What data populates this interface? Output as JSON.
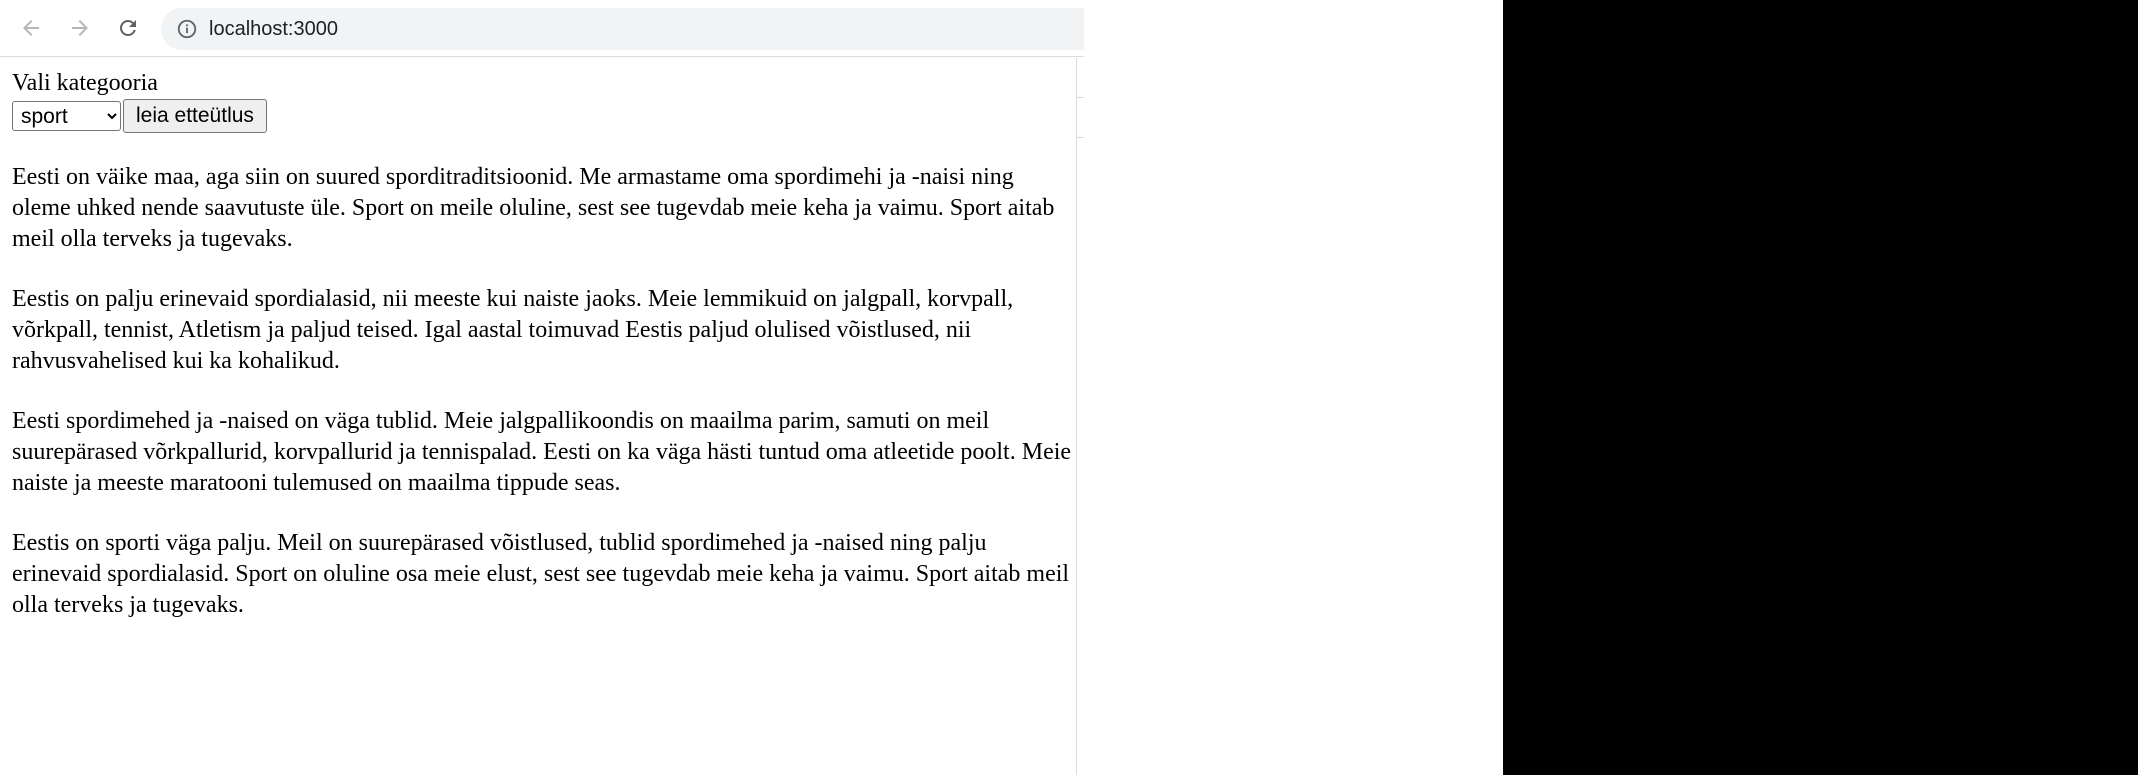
{
  "browser": {
    "url": "localhost:3000",
    "icons": {
      "back": "arrow-left-icon",
      "forward": "arrow-right-icon",
      "reload": "reload-icon",
      "site_info": "info-circle-icon"
    }
  },
  "page": {
    "category_label": "Vali kategooria",
    "category_select": {
      "selected": "sport"
    },
    "find_button_label": "leia etteütlus",
    "paragraphs": [
      "Eesti on väike maa, aga siin on suured sporditraditsioonid. Me armastame oma spordimehi ja -naisi ning oleme uhked nende saavutuste üle. Sport on meile oluline, sest see tugevdab meie keha ja vaimu. Sport aitab meil olla terveks ja tugevaks.",
      "Eestis on palju erinevaid spordialasid, nii meeste kui naiste jaoks. Meie lemmikuid on jalgpall, korvpall, võrkpall, tennist, Atletism ja paljud teised. Igal aastal toimuvad Eestis paljud olulised võistlused, nii rahvusvahelised kui ka kohalikud.",
      "Eesti spordimehed ja -naised on väga tublid. Meie jalgpallikoondis on maailma parim, samuti on meil suurepärased võrkpallurid, korvpallurid ja tennispalad. Eesti on ka väga hästi tuntud oma atleetide poolt. Meie naiste ja meeste maratooni tulemused on maailma tippude seas.",
      "Eestis on sporti väga palju. Meil on suurepärased võistlused, tublid spordimehed ja -naised ning palju erinevaid spordialasid. Sport on oluline osa meie elust, sest see tugevdab meie keha ja vaimu. Sport aitab meil olla terveks ja tugevaks."
    ]
  }
}
